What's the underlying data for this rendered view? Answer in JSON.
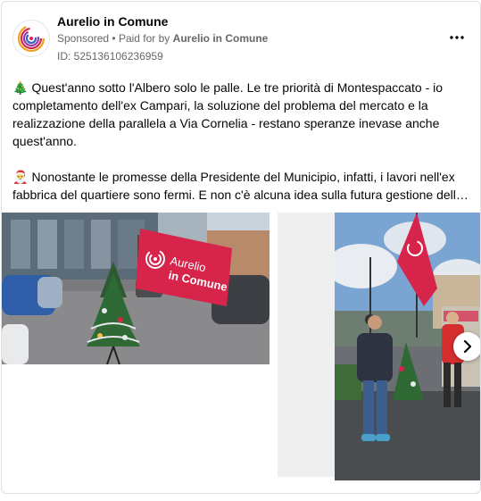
{
  "page": {
    "name": "Aurelio in Comune",
    "sponsored_label": "Sponsored",
    "separator": "•",
    "paid_for_label": "Paid for by",
    "paid_for_by": "Aurelio in Comune",
    "ad_id_text": "ID: 525136106236959"
  },
  "post": {
    "paragraph1": {
      "emoji": "🎄",
      "text": "Quest'anno sotto l'Albero solo le palle. Le tre priorità di Montespaccato - io completamento dell'ex Campari, la soluzione del problema del mercato e la realizzazione della parallela a Via Cornelia - restano speranze inevase anche quest'anno."
    },
    "paragraph2": {
      "emoji": "🎅",
      "text": "Nonostante le promesse della Presidente del Municipio, infatti, i lavori nell'ex fabbrica del quartiere sono fermi. E non c'è alcuna idea sulla futura gestione dello mercato e sul progetto della parallela."
    }
  },
  "carousel": {
    "flag_text_line1": "Aurelio",
    "flag_text_line2": "in Comune"
  },
  "icons": {
    "avatar": "aurelio-spiral-logo",
    "more": "ellipsis-icon",
    "next": "chevron-right-icon"
  },
  "colors": {
    "brand_red": "#d6244a",
    "muted_text": "#65676b"
  }
}
